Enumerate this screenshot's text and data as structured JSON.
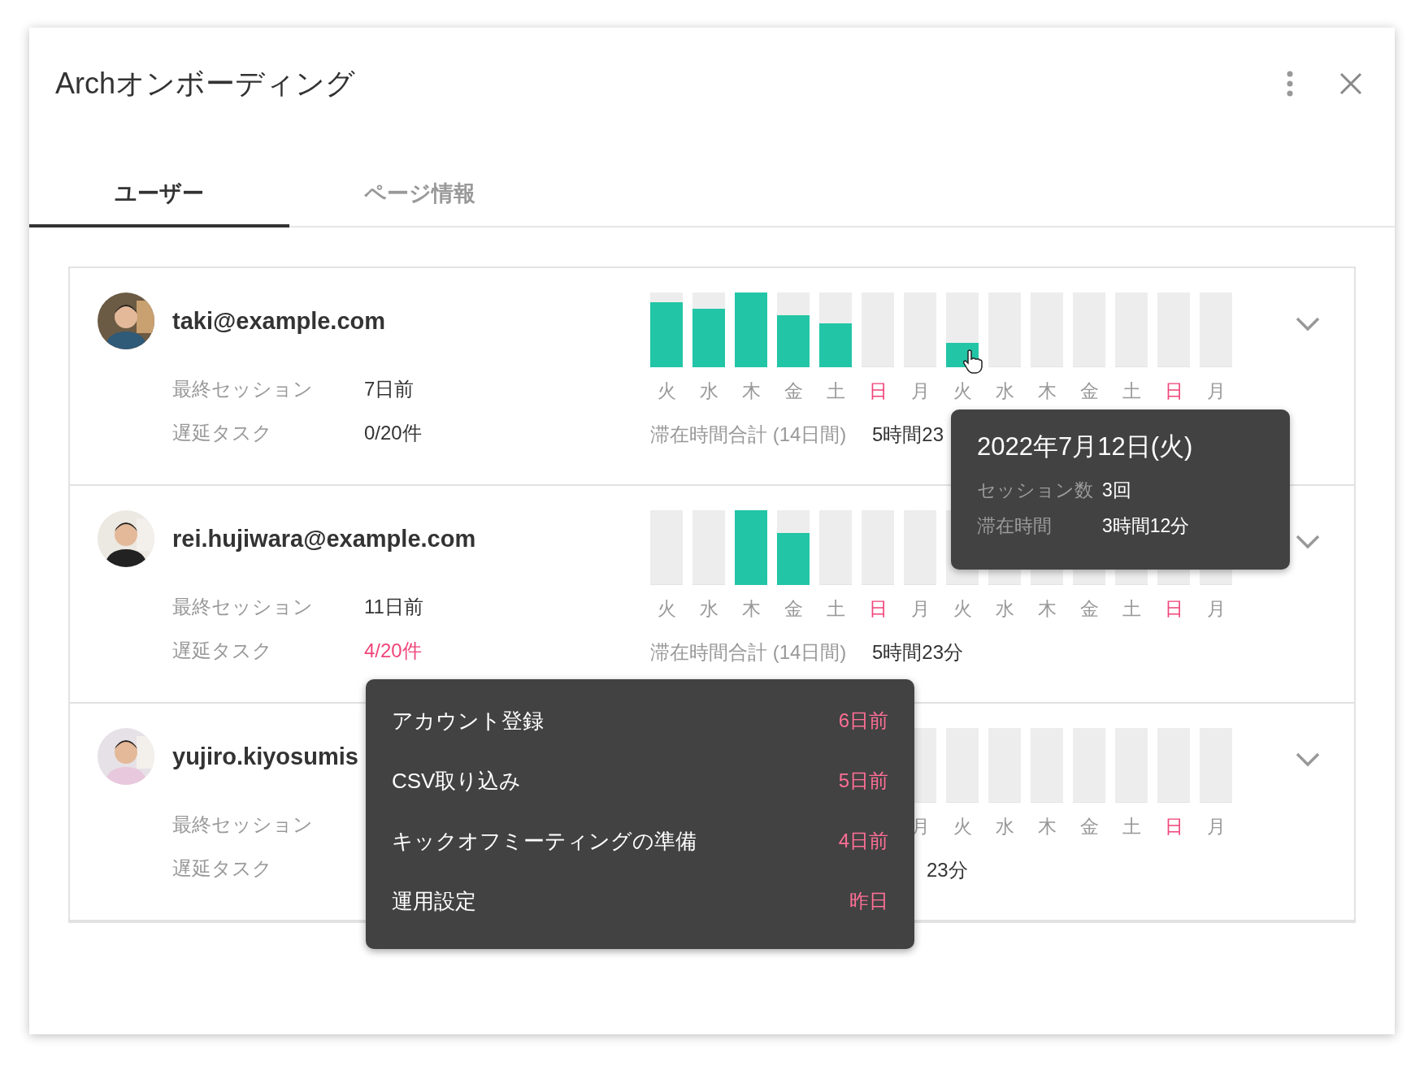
{
  "dialog": {
    "title": "Archオンボーディング"
  },
  "tabs": [
    {
      "label": "ユーザー",
      "selected": true
    },
    {
      "label": "ページ情報",
      "selected": false
    }
  ],
  "users": [
    {
      "email": "taki@example.com",
      "fields": [
        {
          "label": "最終セッション",
          "value": "7日前",
          "alert": false
        },
        {
          "label": "遅延タスク",
          "value": "0/20件",
          "alert": false
        }
      ],
      "days": [
        {
          "day": "火",
          "level": 0.87,
          "sunday": false
        },
        {
          "day": "水",
          "level": 0.78,
          "sunday": false
        },
        {
          "day": "木",
          "level": 1,
          "sunday": false
        },
        {
          "day": "金",
          "level": 0.7,
          "sunday": false
        },
        {
          "day": "土",
          "level": 0.59,
          "sunday": false
        },
        {
          "day": "日",
          "level": 0,
          "sunday": true
        },
        {
          "day": "月",
          "level": 0,
          "sunday": false
        },
        {
          "day": "火",
          "level": 0.33,
          "sunday": false
        },
        {
          "day": "水",
          "level": 0,
          "sunday": false
        },
        {
          "day": "木",
          "level": 0,
          "sunday": false
        },
        {
          "day": "金",
          "level": 0,
          "sunday": false
        },
        {
          "day": "土",
          "level": 0,
          "sunday": false
        },
        {
          "day": "日",
          "level": 0,
          "sunday": true
        },
        {
          "day": "月",
          "level": 0,
          "sunday": false
        }
      ],
      "total": {
        "label": "滞在時間合計 (14日間)",
        "value": "5時間23"
      }
    },
    {
      "email": "rei.hujiwara@example.com",
      "fields": [
        {
          "label": "最終セッション",
          "value": "11日前",
          "alert": false
        },
        {
          "label": "遅延タスク",
          "value": "4/20件",
          "alert": true
        }
      ],
      "days": [
        {
          "day": "火",
          "level": 0,
          "sunday": false
        },
        {
          "day": "水",
          "level": 0,
          "sunday": false
        },
        {
          "day": "木",
          "level": 1,
          "sunday": false
        },
        {
          "day": "金",
          "level": 0.7,
          "sunday": false
        },
        {
          "day": "土",
          "level": 0,
          "sunday": false
        },
        {
          "day": "日",
          "level": 0,
          "sunday": true
        },
        {
          "day": "月",
          "level": 0,
          "sunday": false
        },
        {
          "day": "火",
          "level": 0,
          "sunday": false
        },
        {
          "day": "水",
          "level": 0,
          "sunday": false
        },
        {
          "day": "木",
          "level": 0,
          "sunday": false
        },
        {
          "day": "金",
          "level": 0,
          "sunday": false
        },
        {
          "day": "土",
          "level": 0,
          "sunday": false
        },
        {
          "day": "日",
          "level": 0,
          "sunday": true
        },
        {
          "day": "月",
          "level": 0,
          "sunday": false
        }
      ],
      "total": {
        "label": "滞在時間合計 (14日間)",
        "value": "5時間23分"
      }
    },
    {
      "email": "yujiro.kiyosumis",
      "fields": [
        {
          "label": "最終セッション"
        },
        {
          "label": "遅延タスク"
        }
      ],
      "days": [
        {
          "day": "月",
          "level": 0,
          "sunday": false
        },
        {
          "day": "火",
          "level": 0,
          "sunday": false
        },
        {
          "day": "水",
          "level": 0,
          "sunday": false
        },
        {
          "day": "木",
          "level": 0,
          "sunday": false
        },
        {
          "day": "金",
          "level": 0,
          "sunday": false
        },
        {
          "day": "土",
          "level": 0,
          "sunday": false
        },
        {
          "day": "日",
          "level": 0,
          "sunday": true
        },
        {
          "day": "月",
          "level": 0,
          "sunday": false
        }
      ],
      "total": {
        "value": "23分"
      }
    }
  ],
  "tooltip": {
    "title": "2022年7月12日(火)",
    "rows": [
      {
        "label": "セッション数",
        "value": "3回"
      },
      {
        "label": "滞在時間",
        "value": "3時間12分"
      }
    ]
  },
  "task_menu": {
    "items": [
      {
        "label": "アカウント登録",
        "when": "6日前"
      },
      {
        "label": "CSV取り込み",
        "when": "5日前"
      },
      {
        "label": "キックオフミーティングの準備",
        "when": "4日前"
      },
      {
        "label": "運用設定",
        "when": "昨日"
      }
    ]
  }
}
